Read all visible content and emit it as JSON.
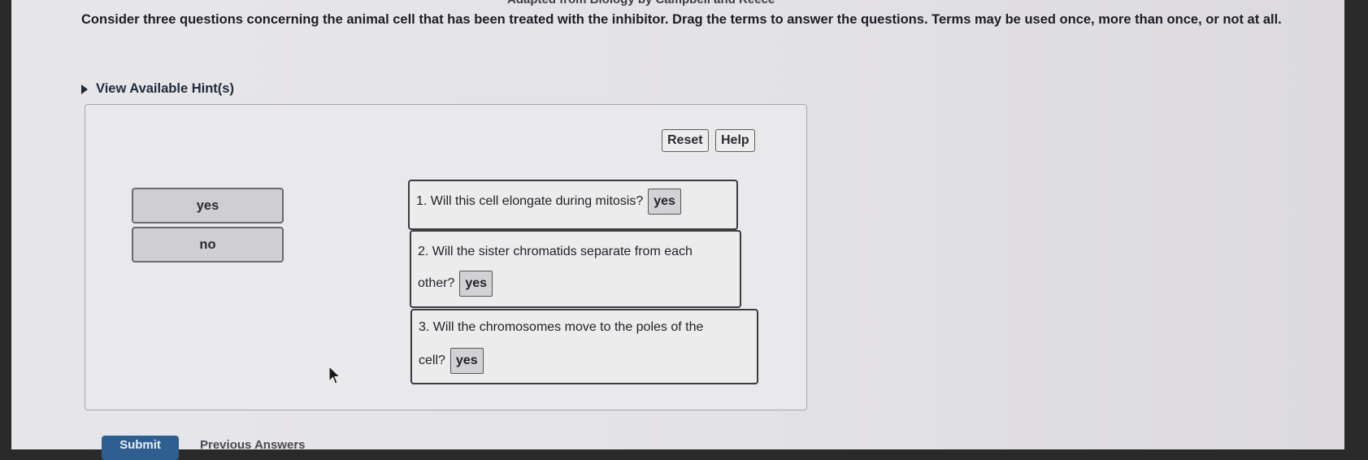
{
  "header": {
    "cut_text": "Adapted from Biology by Campbell and Reece",
    "instructions": "Consider three questions concerning the animal cell that has been treated with the inhibitor. Drag the terms to answer the questions. Terms may be used once, more than once, or not at all."
  },
  "hint": {
    "label": "View Available Hint(s)"
  },
  "toolbar": {
    "reset_label": "Reset",
    "help_label": "Help"
  },
  "terms": [
    "yes",
    "no"
  ],
  "questions": [
    {
      "line1": "1. Will this cell elongate during mitosis?",
      "line2": "",
      "answer": "yes"
    },
    {
      "line1": "2. Will the sister chromatids separate from each",
      "line2": "other?",
      "answer": "yes"
    },
    {
      "line1": "3. Will the chromosomes move to the poles of the",
      "line2": "cell?",
      "answer": "yes"
    }
  ],
  "footer": {
    "submit_label": "Submit",
    "previous_label": "Previous Answers"
  },
  "colors": {
    "submit_bg": "#2e5f90",
    "text_dark": "#1d1d25"
  }
}
